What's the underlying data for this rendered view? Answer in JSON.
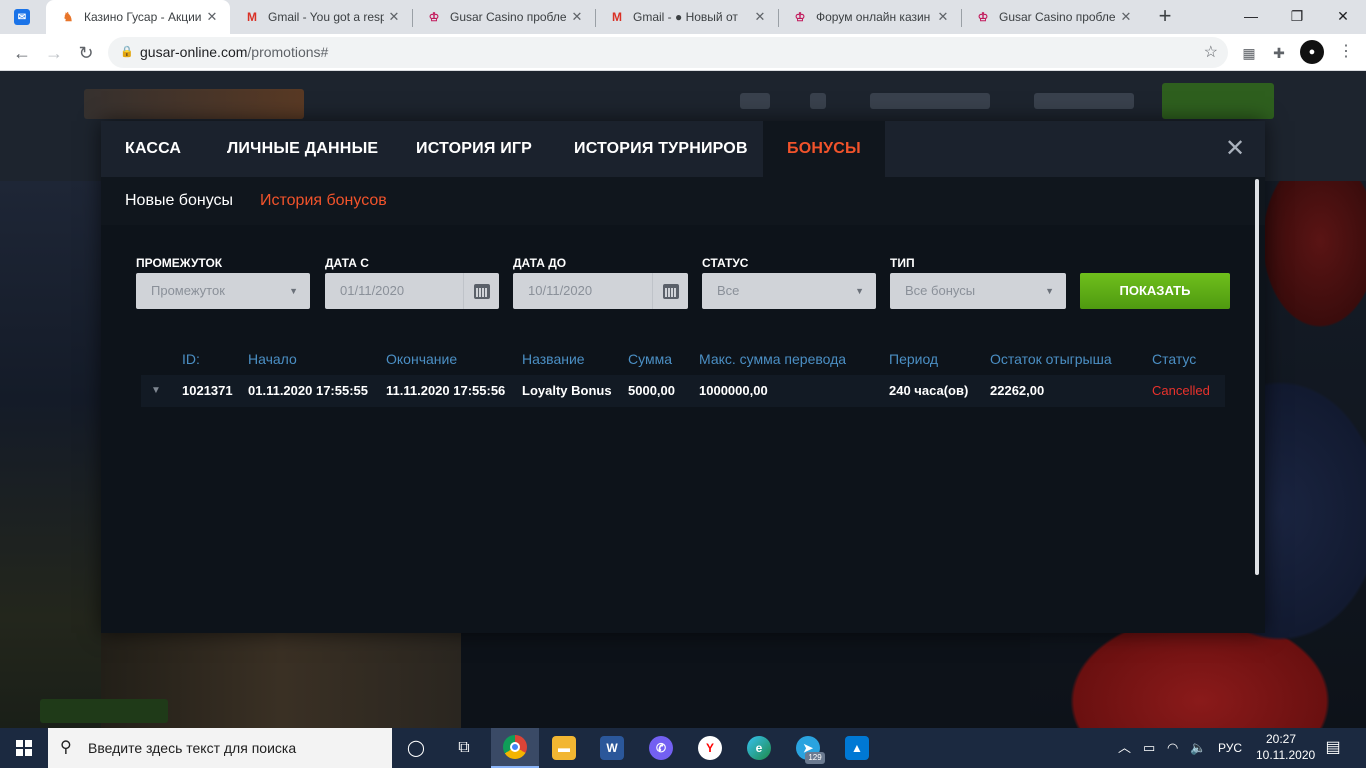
{
  "browser": {
    "tabs": [
      {
        "title": "",
        "favicon": "mail-app-icon",
        "color": "#1a73e8",
        "glyph": "✉"
      },
      {
        "title": "Казино Гусар - Акции",
        "favicon": "gusar-icon",
        "color": "#e8752a",
        "glyph": "♞",
        "active": true
      },
      {
        "title": "Gmail - You got a resp",
        "favicon": "gmail-icon",
        "color": "#d93025",
        "glyph": "M"
      },
      {
        "title": "Gusar Casino пробле",
        "favicon": "forum-icon",
        "color": "#c2185b",
        "glyph": "♔"
      },
      {
        "title": "Gmail - ● Новый от",
        "favicon": "gmail-icon",
        "color": "#d93025",
        "glyph": "M"
      },
      {
        "title": "Форум онлайн казин",
        "favicon": "forum-icon",
        "color": "#c2185b",
        "glyph": "♔"
      },
      {
        "title": "Gusar Casino пробле",
        "favicon": "forum-icon",
        "color": "#c2185b",
        "glyph": "♔"
      }
    ],
    "address": {
      "host": "gusar-online.com",
      "path": "/promotions#"
    }
  },
  "modal": {
    "nav": [
      "КАССА",
      "ЛИЧНЫЕ ДАННЫЕ",
      "ИСТОРИЯ ИГР",
      "ИСТОРИЯ ТУРНИРОВ",
      "БОНУСЫ"
    ],
    "subnav": {
      "new_bonuses": "Новые бонусы",
      "bonus_history": "История бонусов"
    },
    "filters": {
      "period_label": "ПРОМЕЖУТОК",
      "period_value": "Промежуток",
      "date_from_label": "ДАТА С",
      "date_from_value": "01/11/2020",
      "date_to_label": "ДАТА ДО",
      "date_to_value": "10/11/2020",
      "status_label": "СТАТУС",
      "status_value": "Все",
      "type_label": "ТИП",
      "type_value": "Все бонусы",
      "show_button": "ПОКАЗАТЬ"
    },
    "table": {
      "headers": [
        "ID:",
        "Начало",
        "Окончание",
        "Название",
        "Сумма",
        "Макс. сумма перевода",
        "Период",
        "Остаток отыгрыша",
        "Статус"
      ],
      "rows": [
        [
          "1021371",
          "01.11.2020 17:55:55",
          "11.11.2020 17:55:56",
          "Loyalty Bonus",
          "5000,00",
          "1000000,00",
          "240 часа(ов)",
          "22262,00",
          "Cancelled"
        ]
      ]
    }
  },
  "taskbar": {
    "search_placeholder": "Введите здесь текст для поиска",
    "language": "РУС",
    "time": "20:27",
    "date": "10.11.2020",
    "telegram_badge": "129"
  },
  "colors": {
    "accent": "#f1532b",
    "link": "#4b8fc4",
    "status_cancelled": "#e8322c",
    "button_green": "#5fae16"
  }
}
